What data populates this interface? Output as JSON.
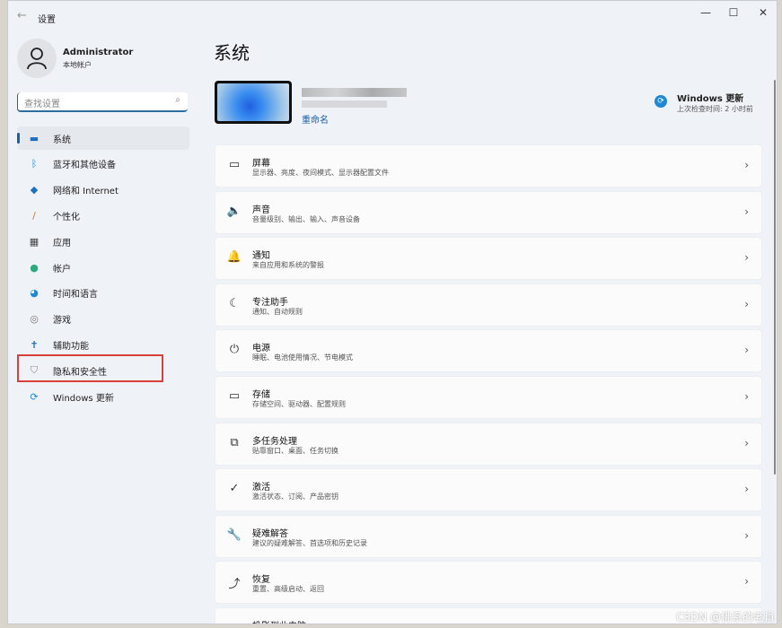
{
  "window": {
    "title": "设置",
    "minimize": "—",
    "maximize": "☐",
    "close": "✕"
  },
  "user": {
    "name": "Administrator",
    "type": "本地帐户"
  },
  "search": {
    "placeholder": "查找设置"
  },
  "nav": [
    {
      "label": "系统",
      "icon": "display-icon",
      "glyph": "▬",
      "color": "#1e6fc0"
    },
    {
      "label": "蓝牙和其他设备",
      "icon": "bluetooth-icon",
      "glyph": "ᛒ",
      "color": "#1e88d6"
    },
    {
      "label": "网络和 Internet",
      "icon": "wifi-icon",
      "glyph": "◆",
      "color": "#1e6fc0"
    },
    {
      "label": "个性化",
      "icon": "brush-icon",
      "glyph": "/",
      "color": "#c77a30"
    },
    {
      "label": "应用",
      "icon": "apps-icon",
      "glyph": "▦",
      "color": "#444"
    },
    {
      "label": "帐户",
      "icon": "person-icon",
      "glyph": "●",
      "color": "#2bab7d"
    },
    {
      "label": "时间和语言",
      "icon": "globe-clock-icon",
      "glyph": "◕",
      "color": "#1e88d6"
    },
    {
      "label": "游戏",
      "icon": "gamepad-icon",
      "glyph": "◎",
      "color": "#777"
    },
    {
      "label": "辅助功能",
      "icon": "accessibility-icon",
      "glyph": "✝",
      "color": "#1e6fc0"
    },
    {
      "label": "隐私和安全性",
      "icon": "shield-icon",
      "glyph": "⛉",
      "color": "#888"
    },
    {
      "label": "Windows 更新",
      "icon": "update-icon",
      "glyph": "⟳",
      "color": "#1e88d6"
    }
  ],
  "main": {
    "title": "系统",
    "device_name_blurred": "",
    "rename": "重命名",
    "update": {
      "title": "Windows 更新",
      "subtitle": "上次检查时间: 2 小时前"
    },
    "cards": [
      {
        "title": "屏幕",
        "subtitle": "显示器、亮度、夜间模式、显示器配置文件",
        "icon": "monitor-icon",
        "glyph": "▭"
      },
      {
        "title": "声音",
        "subtitle": "音量级别、输出、输入、声音设备",
        "icon": "speaker-icon",
        "glyph": "🔈"
      },
      {
        "title": "通知",
        "subtitle": "来自应用和系统的警报",
        "icon": "bell-icon",
        "glyph": "🔔"
      },
      {
        "title": "专注助手",
        "subtitle": "通知、自动规则",
        "icon": "moon-icon",
        "glyph": "☾"
      },
      {
        "title": "电源",
        "subtitle": "睡眠、电池使用情况、节电模式",
        "icon": "power-icon",
        "glyph": "⏻"
      },
      {
        "title": "存储",
        "subtitle": "存储空间、驱动器、配置规则",
        "icon": "drive-icon",
        "glyph": "▭"
      },
      {
        "title": "多任务处理",
        "subtitle": "贴靠窗口、桌面、任务切换",
        "icon": "multitask-icon",
        "glyph": "⧉"
      },
      {
        "title": "激活",
        "subtitle": "激活状态、订阅、产品密钥",
        "icon": "check-circle-icon",
        "glyph": "✓"
      },
      {
        "title": "疑难解答",
        "subtitle": "建议的疑难解答、首选项和历史记录",
        "icon": "wrench-icon",
        "glyph": "🔧"
      },
      {
        "title": "恢复",
        "subtitle": "重置、高级启动、返回",
        "icon": "recovery-icon",
        "glyph": "⤴"
      },
      {
        "title": "投影到此电脑",
        "subtitle": "",
        "icon": "projector-icon",
        "glyph": "▭"
      }
    ]
  },
  "watermark": "CSDN @佛系的老肖"
}
